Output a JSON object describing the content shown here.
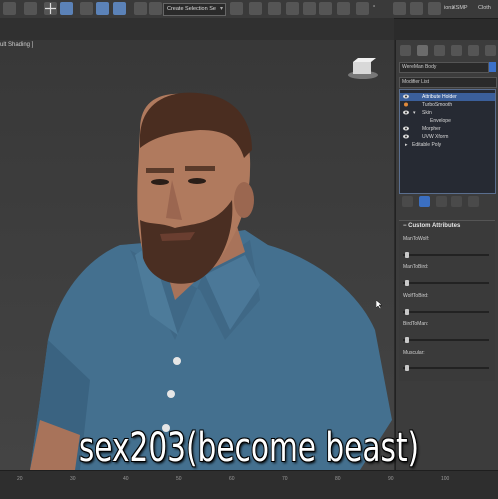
{
  "toolbar": {
    "selection_set": "Create Selection Se",
    "right_label_1": "°",
    "right_label_2": "ions",
    "right_label_3": "XSMP",
    "right_label_4": "Cloth"
  },
  "viewport": {
    "label": "ult Shading ]"
  },
  "panel": {
    "object_name": "WereMan Body",
    "object_color": "#3c71c9",
    "modifier_list": "Modifier List",
    "stack": [
      {
        "label": "Attribute Holder",
        "selected": true
      },
      {
        "label": "TurboSmooth",
        "selected": false
      },
      {
        "label": "Skin",
        "selected": false
      },
      {
        "label": "Envelope",
        "selected": false
      },
      {
        "label": "Morpher",
        "selected": false
      },
      {
        "label": "UVW Xform",
        "selected": false
      },
      {
        "label": "Editable Poly",
        "selected": false
      }
    ],
    "rollout_title": "Custom Attributes",
    "sliders": [
      {
        "label": "ManToWolf:",
        "value": 0
      },
      {
        "label": "ManToBird:",
        "value": 0
      },
      {
        "label": "WolfToBird:",
        "value": 0
      },
      {
        "label": "BirdToMan:",
        "value": 0
      },
      {
        "label": "Muscular:",
        "value": 0
      }
    ]
  },
  "timeline": {
    "ticks": [
      "20",
      "30",
      "40",
      "50",
      "60",
      "70",
      "80",
      "90",
      "100"
    ]
  },
  "caption": "sex203(become beast)"
}
